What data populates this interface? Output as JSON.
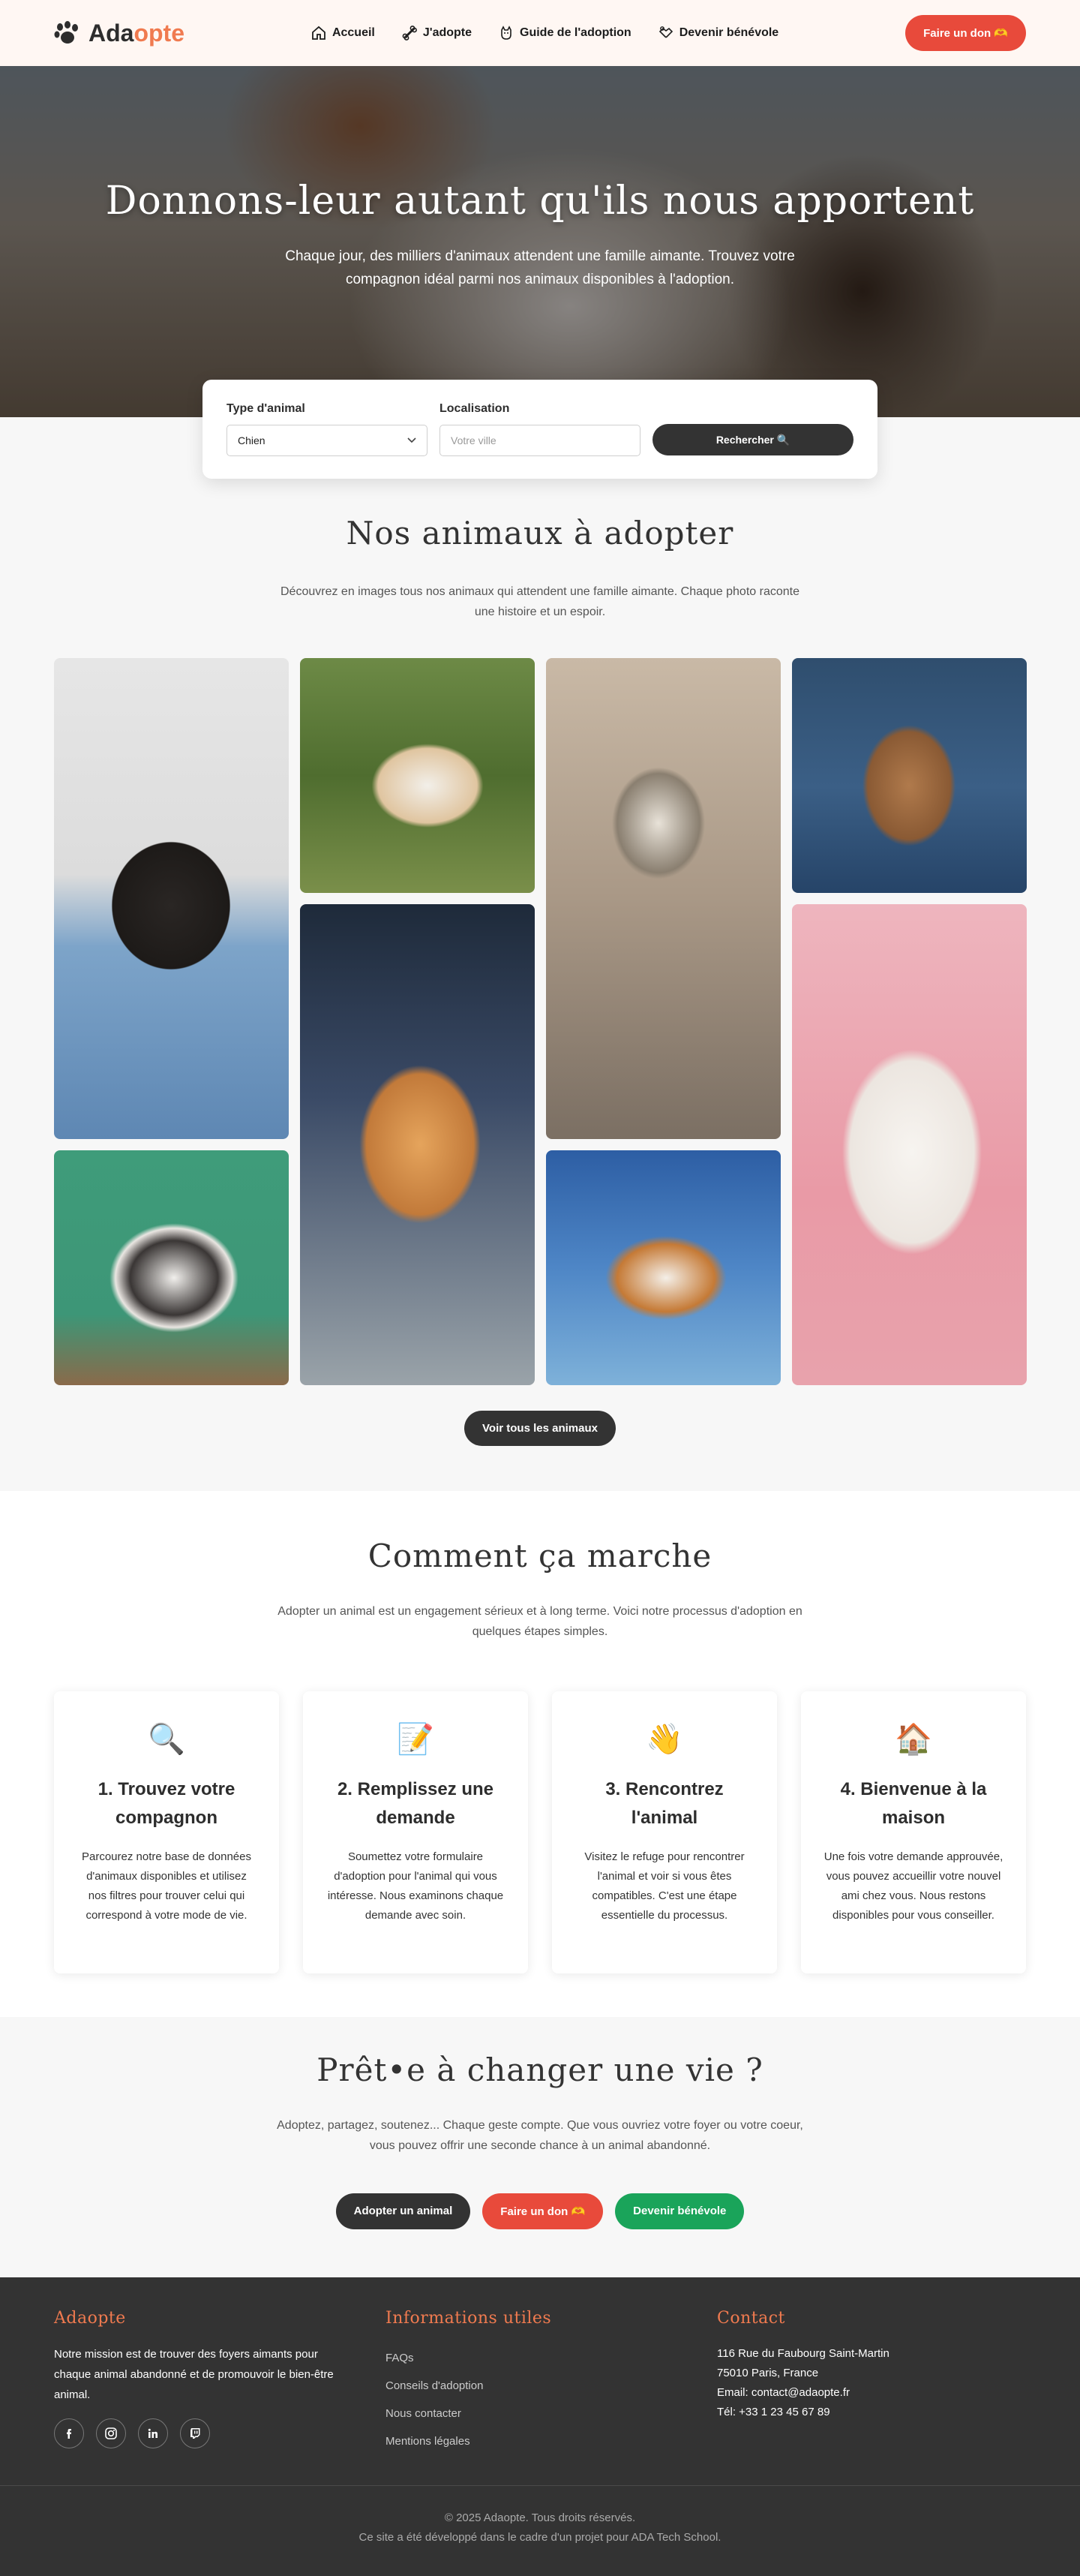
{
  "nav": {
    "logo_prefix": "Ada",
    "logo_suffix": "opte",
    "links": [
      {
        "label": "Accueil",
        "icon": "home-icon"
      },
      {
        "label": "J'adopte",
        "icon": "bone-icon"
      },
      {
        "label": "Guide de l'adoption",
        "icon": "dog-icon"
      },
      {
        "label": "Devenir bénévole",
        "icon": "handshake-icon"
      }
    ],
    "donate_label": "Faire un don 🫶"
  },
  "hero": {
    "title": "Donnons-leur autant qu'ils nous apportent",
    "subtitle": "Chaque jour, des milliers d'animaux attendent une famille aimante. Trouvez votre compagnon idéal parmi nos animaux disponibles à l'adoption."
  },
  "search": {
    "type_label": "Type d'animal",
    "type_value": "Chien",
    "location_label": "Localisation",
    "location_placeholder": "Votre ville",
    "button_label": "Rechercher 🔍"
  },
  "animals": {
    "title": "Nos animaux à adopter",
    "subtitle": "Découvrez en images tous nos animaux qui attendent une famille aimante. Chaque photo raconte une histoire et un espoir.",
    "see_all_label": "Voir tous les animaux"
  },
  "how": {
    "title": "Comment ça marche",
    "subtitle": "Adopter un animal est un engagement sérieux et à long terme. Voici notre processus d'adoption en quelques étapes simples.",
    "steps": [
      {
        "icon": "🔍",
        "title": "1. Trouvez votre compagnon",
        "text": "Parcourez notre base de données d'animaux disponibles et utilisez nos filtres pour trouver celui qui correspond à votre mode de vie."
      },
      {
        "icon": "📝",
        "title": "2. Remplissez une demande",
        "text": "Soumettez votre formulaire d'adoption pour l'animal qui vous intéresse. Nous examinons chaque demande avec soin."
      },
      {
        "icon": "👋",
        "title": "3. Rencontrez l'animal",
        "text": "Visitez le refuge pour rencontrer l'animal et voir si vous êtes compatibles. C'est une étape essentielle du processus."
      },
      {
        "icon": "🏠",
        "title": "4. Bienvenue à la maison",
        "text": "Une fois votre demande approuvée, vous pouvez accueillir votre nouvel ami chez vous. Nous restons disponibles pour vous conseiller."
      }
    ]
  },
  "cta": {
    "title": "Prêt•e à changer une vie ?",
    "subtitle": "Adoptez, partagez, soutenez... Chaque geste compte. Que vous ouvriez votre foyer ou votre coeur, vous pouvez offrir une seconde chance à un animal abandonné.",
    "adopt_label": "Adopter un animal",
    "donate_label": "Faire un don 🫶",
    "volunteer_label": "Devenir bénévole"
  },
  "footer": {
    "about_title": "Adaopte",
    "about_text": "Notre mission est de trouver des foyers aimants pour chaque animal abandonné et de promouvoir le bien-être animal.",
    "info_title": "Informations utiles",
    "info_links": [
      "FAQs",
      "Conseils d'adoption",
      "Nous contacter",
      "Mentions légales"
    ],
    "contact_title": "Contact",
    "contact_lines": [
      "116 Rue du Faubourg Saint-Martin",
      "75010 Paris, France",
      "Email: contact@adaopte.fr",
      "Tél: +33 1 23 45 67 89"
    ],
    "copyright": "© 2025 Adaopte. Tous droits réservés.",
    "credit": "Ce site a été développé dans le cadre d'un projet pour ADA Tech School."
  },
  "colors": {
    "accent": "#f07a4f",
    "donate": "#e84a3b",
    "volunteer": "#1aa45a",
    "dark": "#333333"
  }
}
